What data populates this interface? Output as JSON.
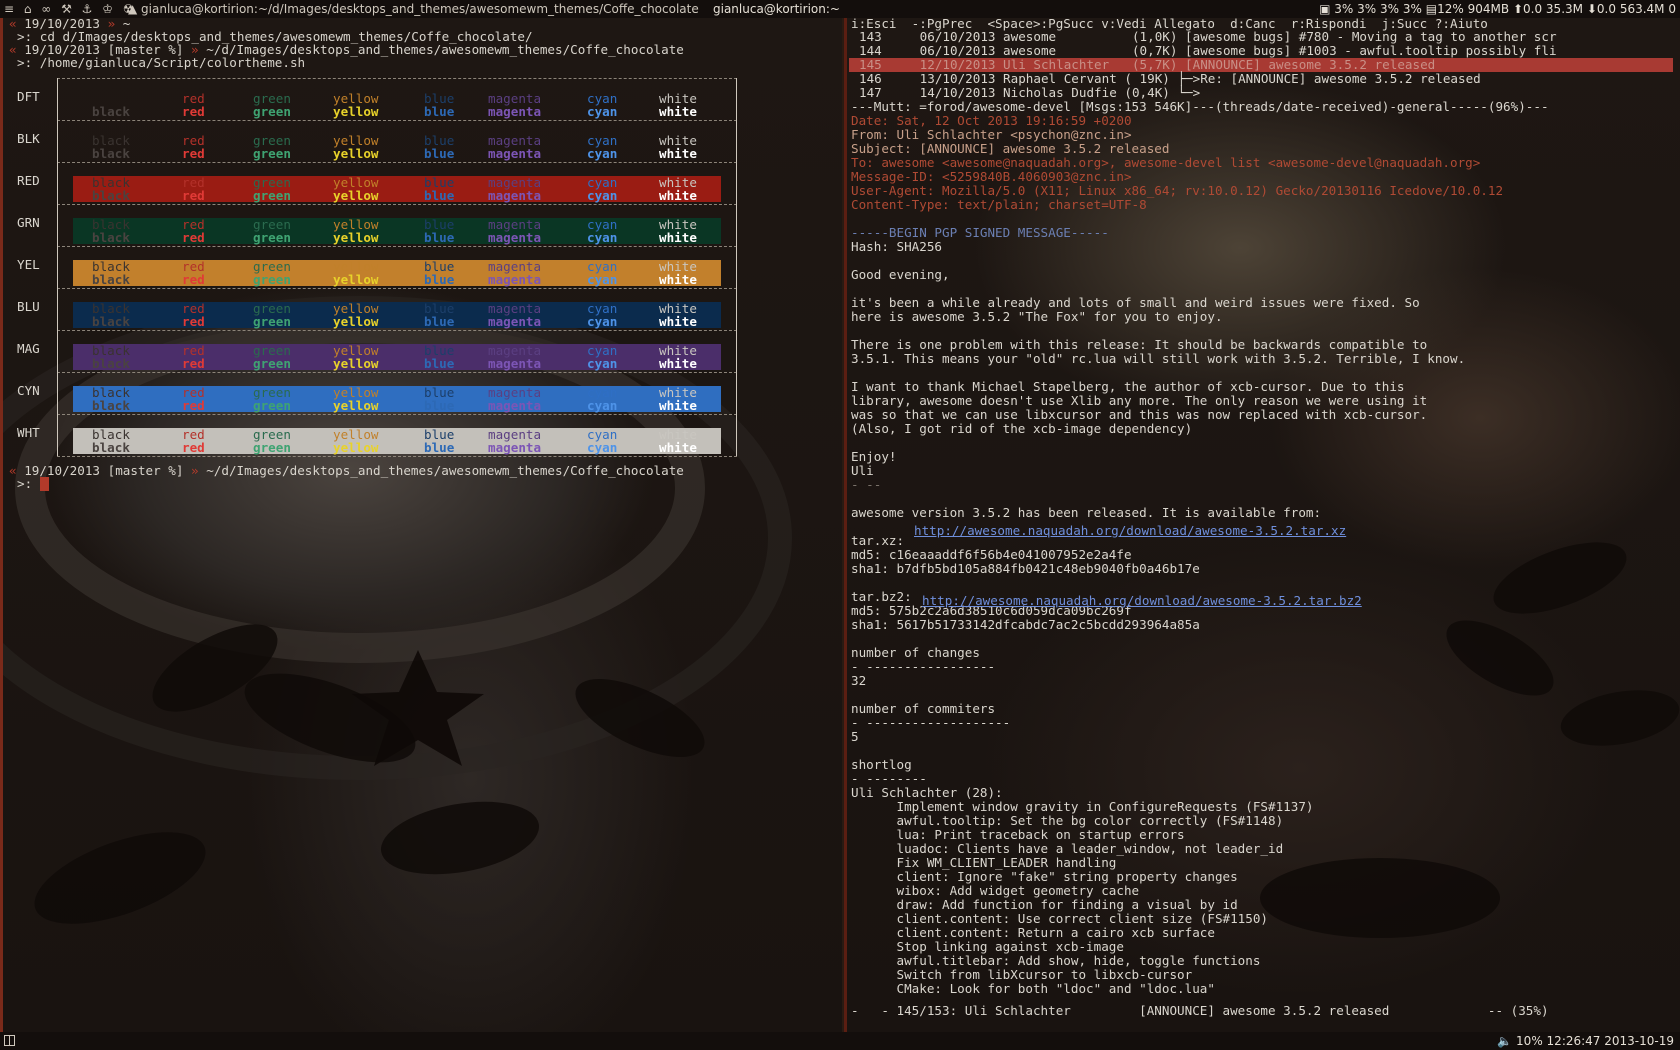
{
  "topbar": {
    "tag_icons": "≡ ⌂ ∞ ⚒ ⚓ ♔ ☢",
    "left_window_title": "gianluca@kortirion:~/d/Images/desktops_and_themes/awesomewm_themes/Coffe_chocolate",
    "right_window_title": "gianluca@kortirion:~",
    "cpu": [
      "3%",
      "3%",
      "3%",
      "3%"
    ],
    "mem_percent": "12%",
    "mem_used": "904MB",
    "net_up_rate": "0.0",
    "net_up_total": "35.3M",
    "net_down_rate": "0.0",
    "net_down_total": "563.4M",
    "last_char": "0"
  },
  "bottombar": {
    "volume": "10%",
    "clock": "12:26:47 2013-10-19"
  },
  "left_terminal": {
    "prompt1": {
      "date": "19/10/2013",
      "path": "~"
    },
    "cmd1": ">: cd d/Images/desktops_and_themes/awesomewm_themes/Coffe_chocolate/",
    "prompt2": {
      "date": "19/10/2013",
      "branch": "[master %]",
      "path": "~/d/Images/desktops_and_themes/awesomewm_themes/Coffe_chocolate"
    },
    "cmd2": ">: /home/gianluca/Script/colortheme.sh",
    "prompt3": {
      "date": "19/10/2013",
      "branch": "[master %]",
      "path": "~/d/Images/desktops_and_themes/awesomewm_themes/Coffe_chocolate"
    },
    "prompt_marker": ">:",
    "colortheme": {
      "names": [
        "black",
        "red",
        "green",
        "yellow",
        "blue",
        "magenta",
        "cyan",
        "white"
      ],
      "normal_colors": [
        "#3a3330",
        "#b3312a",
        "#2a6b4e",
        "#c1802a",
        "#1c3f6a",
        "#5b3f82",
        "#2f6fc5",
        "#c9c6c0"
      ],
      "bright_colors": [
        "#4a4340",
        "#e03a36",
        "#3fa372",
        "#e8d22a",
        "#2d69b5",
        "#7c55b5",
        "#4e93e8",
        "#ffffff"
      ],
      "rows": [
        {
          "label": "DFT",
          "bg": ""
        },
        {
          "label": "BLK",
          "bg": ""
        },
        {
          "label": "RED",
          "bg": "#9a1c13"
        },
        {
          "label": "GRN",
          "bg": "#0a3624"
        },
        {
          "label": "YEL",
          "bg": "#c2802c"
        },
        {
          "label": "BLU",
          "bg": "#0b2b4d"
        },
        {
          "label": "MAG",
          "bg": "#4b2e6a"
        },
        {
          "label": "CYN",
          "bg": "#2f6ec0"
        },
        {
          "label": "WHT",
          "bg": "#c3c0ba"
        }
      ]
    }
  },
  "mutt": {
    "help_line": "i:Esci  -:PgPrec  <Space>:PgSucc v:Vedi Allegato  d:Canc  r:Rispondi  j:Succ ?:Aiuto",
    "index": [
      "143     06/10/2013 awesome          (1,0K) [awesome bugs] #780 - Moving a tag to another scr",
      "144     06/10/2013 awesome          (0,7K) [awesome bugs] #1003 - awful.tooltip possibly fli",
      "145     12/10/2013 Uli Schlachter   (5,7K) [ANNOUNCE] awesome 3.5.2 released",
      "146     13/10/2013 Raphael Cervant ( 19K) ├─>Re: [ANNOUNCE] awesome 3.5.2 released",
      "147     14/10/2013 Nicholas Dudfie (0,4K) └─>"
    ],
    "index_status": "---Mutt: =forod/awesome-devel [Msgs:153 546K]---(threads/date-received)-general-----(96%)---",
    "headers": [
      "Date: Sat, 12 Oct 2013 19:16:59 +0200",
      "From: Uli Schlachter <psychon@znc.in>",
      "Subject: [ANNOUNCE] awesome 3.5.2 released",
      "To: awesome <awesome@naquadah.org>, awesome-devel list <awesome-devel@naquadah.org>",
      "Message-ID: <5259840B.4060903@znc.in>",
      "User-Agent: Mozilla/5.0 (X11; Linux x86_64; rv:10.0.12) Gecko/20130116 Icedove/10.0.12",
      "Content-Type: text/plain; charset=UTF-8"
    ],
    "body": [
      "-----BEGIN PGP SIGNED MESSAGE-----",
      "Hash: SHA256",
      "",
      "Good evening,",
      "",
      "it's been a while already and lots of small and weird issues were fixed. So",
      "here is awesome 3.5.2 \"The Fox\" for you to enjoy.",
      "",
      "There is one problem with this release: It should be backwards compatible to",
      "3.5.1. This means your \"old\" rc.lua will still work with 3.5.2. Terrible, I know.",
      "",
      "I want to thank Michael Stapelberg, the author of xcb-cursor. Due to this",
      "library, awesome doesn't use Xlib any more. The only reason we were using it",
      "was so that we can use libxcursor and this was now replaced with xcb-cursor.",
      "(Also, I got rid of the xcb-image dependency)",
      "",
      "Enjoy!",
      "Uli",
      "- --",
      "",
      "awesome version 3.5.2 has been released. It is available from:",
      "",
      "tar.xz: ",
      "md5: c16eaaaddf6f56b4e041007952e2a4fe",
      "sha1: b7dfb5bd105a884fb0421c48eb9040fb0a46b17e",
      "",
      "tar.bz2: ",
      "md5: 575b2c2a6d38510c6d059dca09bc269f",
      "sha1: 5617b51733142dfcabdc7ac2c5bcdd293964a85a",
      "",
      "number of changes",
      "- -----------------",
      "32",
      "",
      "number of commiters",
      "- -------------------",
      "5",
      "",
      "shortlog",
      "- --------",
      "Uli Schlachter (28):",
      "      Implement window gravity in ConfigureRequests (FS#1137)",
      "      awful.tooltip: Set the bg color correctly (FS#1148)",
      "      lua: Print traceback on startup errors",
      "      luadoc: Clients have a leader_window, not leader_id",
      "      Fix WM_CLIENT_LEADER handling",
      "      client: Ignore \"fake\" string property changes",
      "      wibox: Add widget geometry cache",
      "      draw: Add function for finding a visual by id",
      "      client.content: Use correct client size (FS#1150)",
      "      client.content: Return a cairo xcb surface",
      "      Stop linking against xcb-image",
      "      awful.titlebar: Add show, hide, toggle functions",
      "      Switch from libXcursor to libxcb-cursor",
      "      CMake: Look for both \"ldoc\" and \"ldoc.lua\""
    ],
    "links": {
      "xz": "http://awesome.naquadah.org/download/awesome-3.5.2.tar.xz",
      "bz2": "http://awesome.naquadah.org/download/awesome-3.5.2.tar.bz2"
    },
    "pager_status": "-   - 145/153: Uli Schlachter         [ANNOUNCE] awesome 3.5.2 released             -- (35%)"
  }
}
